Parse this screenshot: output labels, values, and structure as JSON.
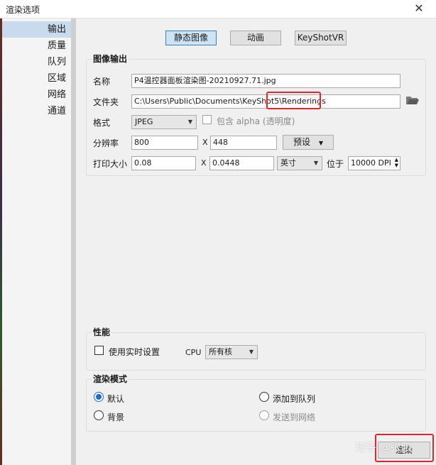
{
  "window": {
    "title": "渲染选项",
    "close_label": "✕"
  },
  "sidebar": {
    "items": [
      {
        "label": "输出"
      },
      {
        "label": "质量"
      },
      {
        "label": "队列"
      },
      {
        "label": "区域"
      },
      {
        "label": "网络"
      },
      {
        "label": "通道"
      }
    ]
  },
  "tabs": [
    {
      "label": "静态图像"
    },
    {
      "label": "动画"
    },
    {
      "label": "KeyShotVR"
    }
  ],
  "image_output": {
    "title": "图像输出",
    "name_label": "名称",
    "name_value": "P4温控器面板渲染图-20210927.71.jpg",
    "folder_label": "文件夹",
    "folder_value": "C:\\Users\\Public\\Documents\\KeyShot5\\Renderings",
    "format_label": "格式",
    "format_value": "JPEG",
    "alpha_label": "包含 alpha (透明度)",
    "resolution_label": "分辨率",
    "width_value": "800",
    "height_value": "448",
    "x_sep": "X",
    "preset_label": "预设",
    "print_label": "打印大小",
    "print_w": "0.08",
    "print_h": "0.0448",
    "unit_value": "英寸",
    "at_label": "位于",
    "dpi_value": "10000 DPI"
  },
  "performance": {
    "title": "性能",
    "realtime_label": "使用实时设置",
    "cpu_label": "CPU",
    "cpu_value": "所有核"
  },
  "render_mode": {
    "title": "渲染模式",
    "default_label": "默认",
    "add_queue_label": "添加到队列",
    "background_label": "背景",
    "send_network_label": "发送到网络"
  },
  "render_button": {
    "label": "渲染"
  },
  "watermark": {
    "text": "知乎 @张阳"
  },
  "colors": {
    "accent": "#1c6fd1",
    "highlight": "#e0262b",
    "selected_bg": "#c9d9ee"
  }
}
